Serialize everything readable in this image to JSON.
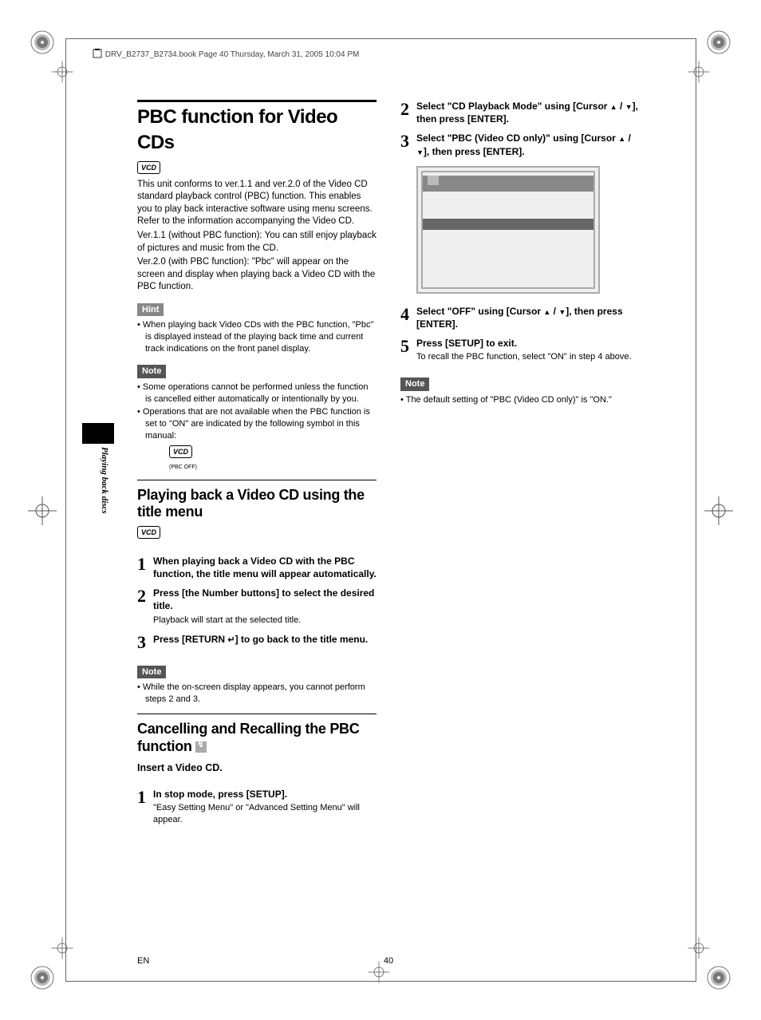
{
  "meta": {
    "header": "DRV_B2737_B2734.book  Page 40  Thursday, March 31, 2005  10:04 PM"
  },
  "sidebar": {
    "label": "Playing back discs"
  },
  "left": {
    "title": "PBC function for Video CDs",
    "vcd": "VCD",
    "para1": "This unit conforms to ver.1.1 and ver.2.0 of the Video CD standard playback control (PBC) function. This enables you to play back interactive software using menu screens. Refer to the information accompanying the Video CD.",
    "para2": "Ver.1.1 (without PBC function): You can still enjoy playback of pictures and music from the CD.",
    "para3": "Ver.2.0 (with PBC function): \"Pbc\" will appear on the screen and display when playing back a Video CD with the PBC function.",
    "hint_label": "Hint",
    "hint1": "When playing back Video CDs with the PBC function, \"Pbc\" is displayed instead of the playing back time and current track indications on the front panel display.",
    "note_label": "Note",
    "note1": "Some operations cannot be performed unless the function is cancelled either automatically or intentionally by you.",
    "note2": "Operations that are not available when the PBC function is set to \"ON\" are indicated by the following symbol in this manual:",
    "pbc_off": "(PBC OFF)",
    "sub1_title": "Playing back a Video CD using the title menu",
    "s1": "When playing back a Video CD with the PBC function, the title menu will appear automatically.",
    "s2": "Press [the Number buttons] to select the desired title.",
    "s2_sub": "Playback will start at the selected title.",
    "s3a": "Press [RETURN ",
    "s3b": "] to go back to the title menu.",
    "note2_label": "Note",
    "note3": "While the on-screen display appears, you cannot perform steps 2 and 3.",
    "sub2_title": "Cancelling and Recalling the PBC function ",
    "insert": "Insert a Video CD.",
    "c1": "In stop mode, press [SETUP].",
    "c1_sub": "\"Easy Setting Menu\" or \"Advanced Setting Menu\" will appear."
  },
  "right": {
    "c2a": "Select \"CD Playback Mode\" using [Cursor ",
    "c2b": "], then press [ENTER].",
    "c3a": "Select \"PBC (Video CD only)\" using [Cursor ",
    "c3b": "], then press [ENTER].",
    "c4a": "Select \"OFF\" using [Cursor ",
    "c4b": "], then press [ENTER].",
    "c5": "Press [SETUP] to exit.",
    "c5_sub": "To recall the PBC function, select \"ON\" in step 4 above.",
    "note_label": "Note",
    "note1": "The default setting of \"PBC (Video CD only)\" is \"ON.\""
  },
  "footer": {
    "lang": "EN",
    "page": "40"
  }
}
